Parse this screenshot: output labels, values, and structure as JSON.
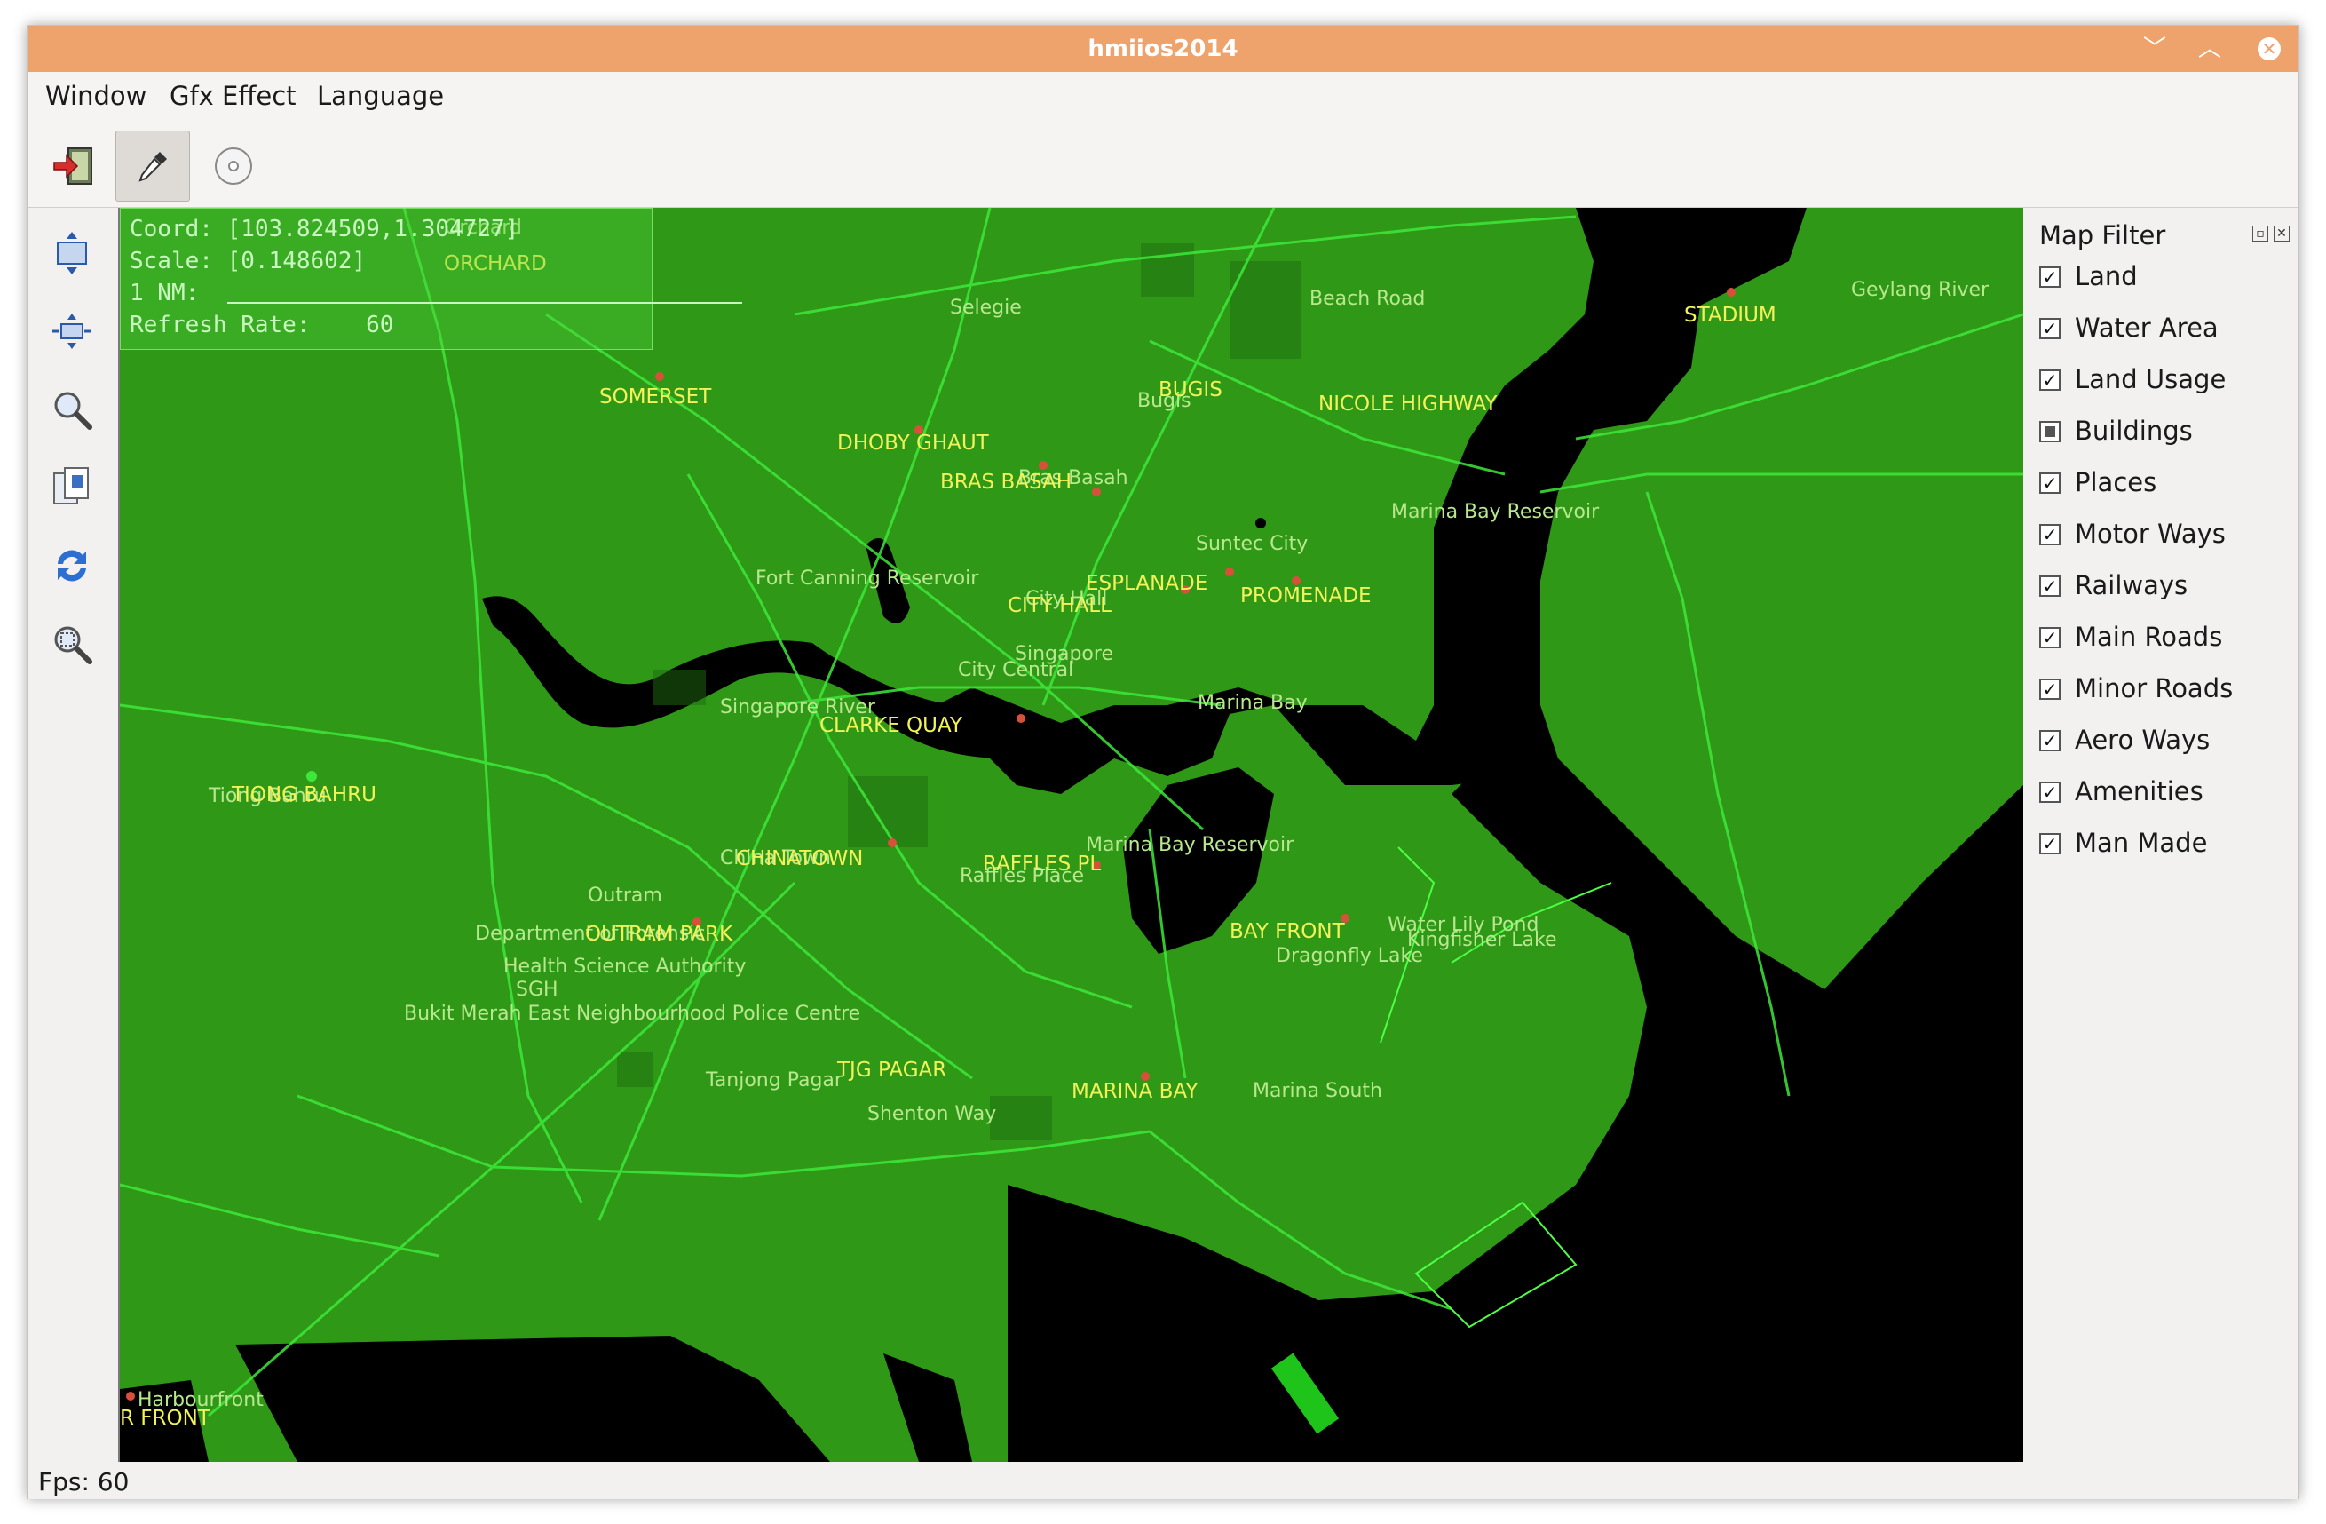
{
  "window": {
    "title": "hmiios2014"
  },
  "titlebar": {
    "minimize_glyph": "﹀",
    "maximize_glyph": "︿",
    "close_glyph": "✕"
  },
  "menu": [
    "Window",
    "Gfx Effect",
    "Language"
  ],
  "toolbar": {
    "tools": [
      {
        "icon": "exit-icon"
      },
      {
        "icon": "eyedropper-icon",
        "active": true
      },
      {
        "icon": "disc-icon"
      }
    ]
  },
  "sidetools": [
    {
      "icon": "fit-view-icon"
    },
    {
      "icon": "fit-width-icon"
    },
    {
      "icon": "zoom-icon"
    },
    {
      "icon": "copy-icon"
    },
    {
      "icon": "refresh-icon"
    },
    {
      "icon": "zoom-region-icon"
    }
  ],
  "hud": {
    "coord_label": "Coord:",
    "coord_value": "[103.824509,1.304727]",
    "scale_label": "Scale:",
    "scale_value": "[0.148602]",
    "nm_label": "1 NM:",
    "refresh_label": "Refresh Rate:",
    "refresh_value": "60"
  },
  "map": {
    "colors": {
      "land": "#2f9816",
      "water": "#000000",
      "roads": "#3ee83a",
      "places": "#b8e88e",
      "stations": "#f2f25a"
    },
    "places": [
      "Orchard",
      "Selegie",
      "Beach Road",
      "Geylang River",
      "Bugis",
      "Bras Basah",
      "Fort Canning Reservoir",
      "City Hall",
      "Singapore",
      "City Central",
      "Suntec City",
      "Marina Bay Reservoir",
      "Marina Bay",
      "Singapore River",
      "Tiong Bahru",
      "China Town",
      "Raffles Place",
      "Outram",
      "Department of Forensic",
      "Health Science Authority",
      "SGH",
      "Bukit Merah East Neighbourhood Police Centre",
      "Tanjong Pagar",
      "Shenton Way",
      "Marina Bay Reservoir",
      "Dragonfly Lake",
      "Water Lily Pond",
      "Kingfisher Lake",
      "Marina South",
      "Harbourfront"
    ],
    "stations": [
      "ORCHARD",
      "SOMERSET",
      "DHOBY GHAUT",
      "BRAS BASAH",
      "BUGIS",
      "NICOLE HIGHWAY",
      "STADIUM",
      "ESPLANADE",
      "CITY HALL",
      "PROMENADE",
      "CLARKE QUAY",
      "TIONG BAHRU",
      "CHINATOWN",
      "RAFFLES PL",
      "OUTRAM PARK",
      "TJG PAGAR",
      "MARINA BAY",
      "BAY FRONT",
      "R FRONT"
    ]
  },
  "map_filter": {
    "title": "Map Filter",
    "items": [
      {
        "label": "Land",
        "state": "checked"
      },
      {
        "label": "Water Area",
        "state": "checked"
      },
      {
        "label": "Land Usage",
        "state": "checked"
      },
      {
        "label": "Buildings",
        "state": "partial"
      },
      {
        "label": "Places",
        "state": "checked"
      },
      {
        "label": "Motor Ways",
        "state": "checked"
      },
      {
        "label": "Railways",
        "state": "checked"
      },
      {
        "label": "Main Roads",
        "state": "checked"
      },
      {
        "label": "Minor Roads",
        "state": "checked"
      },
      {
        "label": "Aero Ways",
        "state": "checked"
      },
      {
        "label": "Amenities",
        "state": "checked"
      },
      {
        "label": "Man Made",
        "state": "checked"
      }
    ]
  },
  "status": {
    "fps": "Fps: 60"
  }
}
